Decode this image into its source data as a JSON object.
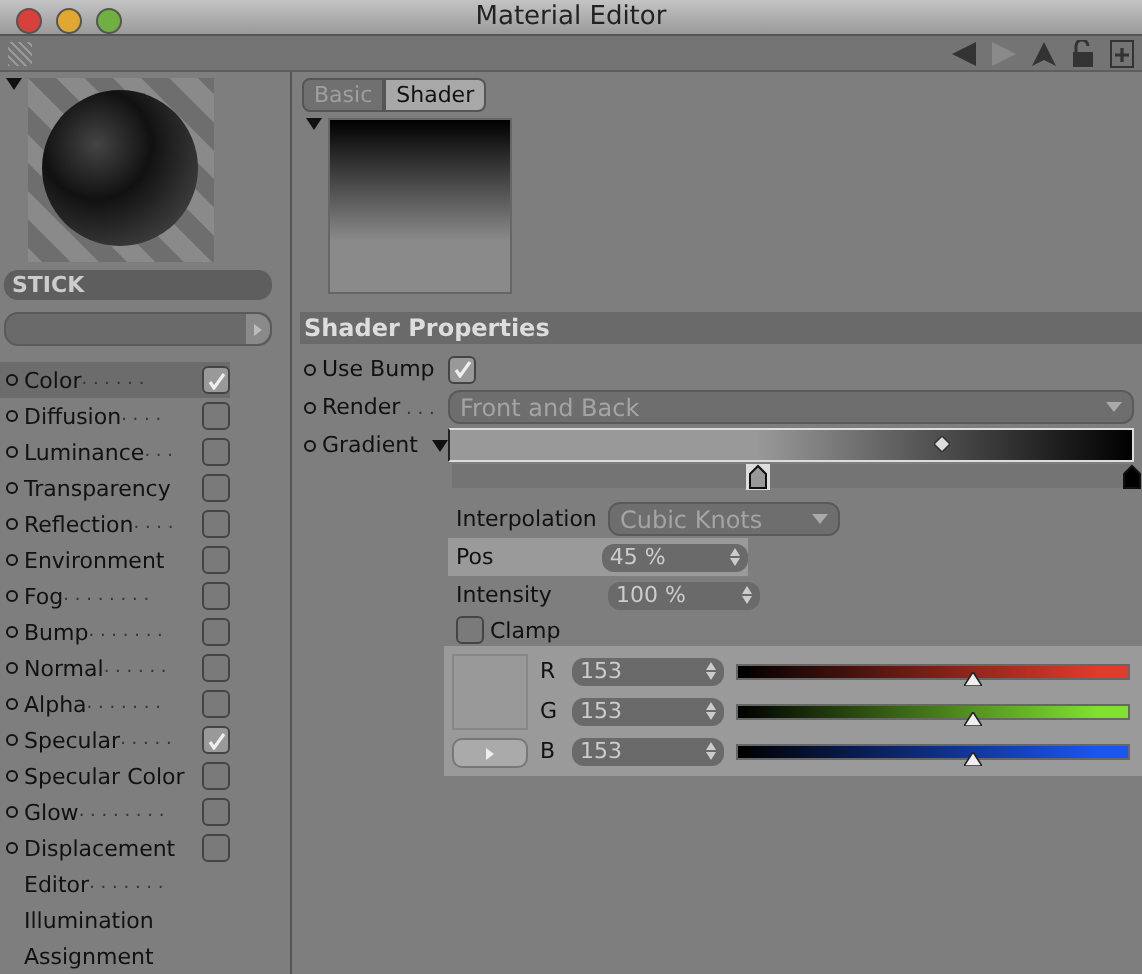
{
  "window": {
    "title": "Material Editor"
  },
  "material": {
    "name": "STICK"
  },
  "channels": [
    {
      "kind": "check",
      "label": "Color",
      "dots": " . . . . . .",
      "checked": true,
      "selected": true
    },
    {
      "kind": "check",
      "label": "Diffusion",
      "dots": " . . . .",
      "checked": false,
      "selected": false
    },
    {
      "kind": "check",
      "label": "Luminance",
      "dots": " . . .",
      "checked": false,
      "selected": false
    },
    {
      "kind": "check",
      "label": "Transparency",
      "checked": false,
      "selected": false
    },
    {
      "kind": "check",
      "label": "Reflection",
      "dots": " . . . .",
      "checked": false,
      "selected": false
    },
    {
      "kind": "check",
      "label": "Environment",
      "checked": false,
      "selected": false
    },
    {
      "kind": "check",
      "label": "Fog",
      "dots": " . . . . . . . .",
      "checked": false,
      "selected": false
    },
    {
      "kind": "check",
      "label": "Bump",
      "dots": " . . . . . . .",
      "checked": false,
      "selected": false
    },
    {
      "kind": "check",
      "label": "Normal",
      "dots": " . . . . . .",
      "checked": false,
      "selected": false
    },
    {
      "kind": "check",
      "label": "Alpha",
      "dots": " . . . . . . .",
      "checked": false,
      "selected": false
    },
    {
      "kind": "check",
      "label": "Specular",
      "dots": " . . . . .",
      "checked": true,
      "selected": false
    },
    {
      "kind": "check",
      "label": "Specular Color",
      "checked": false,
      "selected": false
    },
    {
      "kind": "check",
      "label": "Glow",
      "dots": " . . . . . . . .",
      "checked": false,
      "selected": false
    },
    {
      "kind": "check",
      "label": "Displacement",
      "checked": false,
      "selected": false
    },
    {
      "kind": "plain",
      "label": "Editor",
      "dots": " . . . . . . .",
      "selected": false
    },
    {
      "kind": "plain",
      "label": "Illumination",
      "selected": false
    },
    {
      "kind": "plain",
      "label": "Assignment",
      "selected": false
    }
  ],
  "tabs": [
    {
      "label": "Basic",
      "selected": false
    },
    {
      "label": "Shader",
      "selected": true
    }
  ],
  "section": {
    "title": "Shader Properties"
  },
  "use_bump": {
    "label": "Use Bump",
    "checked": true
  },
  "render": {
    "label": "Render",
    "dots": " . . .",
    "value": "Front and Back"
  },
  "gradient": {
    "label": "Gradient",
    "midpoint": {
      "level": 0.72
    },
    "knots": [
      {
        "level": 0.45,
        "selected": true,
        "color": "#999999"
      },
      {
        "level": 1.0,
        "selected": false,
        "color": "#000000"
      }
    ]
  },
  "interpolation": {
    "label": "Interpolation",
    "value": "Cubic Knots"
  },
  "pos": {
    "label": "Pos",
    "value": "45 %"
  },
  "intensity": {
    "label": "Intensity",
    "value": "100 %"
  },
  "clamp": {
    "label": "Clamp",
    "checked": false
  },
  "rgb": [
    {
      "label": "R",
      "value": "153",
      "level": 0.6,
      "color": "#e03a2a"
    },
    {
      "label": "G",
      "value": "153",
      "level": 0.6,
      "color": "#7fe030"
    },
    {
      "label": "B",
      "value": "153",
      "level": 0.6,
      "color": "#1a55f0"
    }
  ]
}
